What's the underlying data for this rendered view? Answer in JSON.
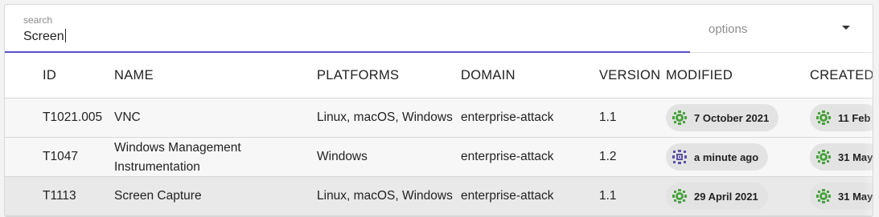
{
  "search": {
    "label": "search",
    "value": "Screen"
  },
  "options": {
    "placeholder": "options"
  },
  "columns": [
    "ID",
    "NAME",
    "PLATFORMS",
    "DOMAIN",
    "VERSION",
    "MODIFIED",
    "CREATED"
  ],
  "rows": [
    {
      "id": "T1021.005",
      "name": "VNC",
      "platforms": "Linux, macOS, Windows",
      "domain": "enterprise-attack",
      "version": "1.1",
      "modified": "7 October 2021",
      "modified_icon": "green-gear-icon",
      "created": "11 Feb"
    },
    {
      "id": "T1047",
      "name": "Windows Management Instrumentation",
      "platforms": "Windows",
      "domain": "enterprise-attack",
      "version": "1.2",
      "modified": "a minute ago",
      "modified_icon": "purple-grid-icon",
      "created": "31 May"
    },
    {
      "id": "T1113",
      "name": "Screen Capture",
      "platforms": "Linux, macOS, Windows",
      "domain": "enterprise-attack",
      "version": "1.1",
      "modified": "29 April 2021",
      "modified_icon": "green-gear-icon",
      "created": "31 May"
    }
  ],
  "colors": {
    "accent": "#5b4fc8",
    "green_icon": "#47a33c",
    "purple_icon": "#5b52a8",
    "chip_bg": "#e3e3e3"
  }
}
